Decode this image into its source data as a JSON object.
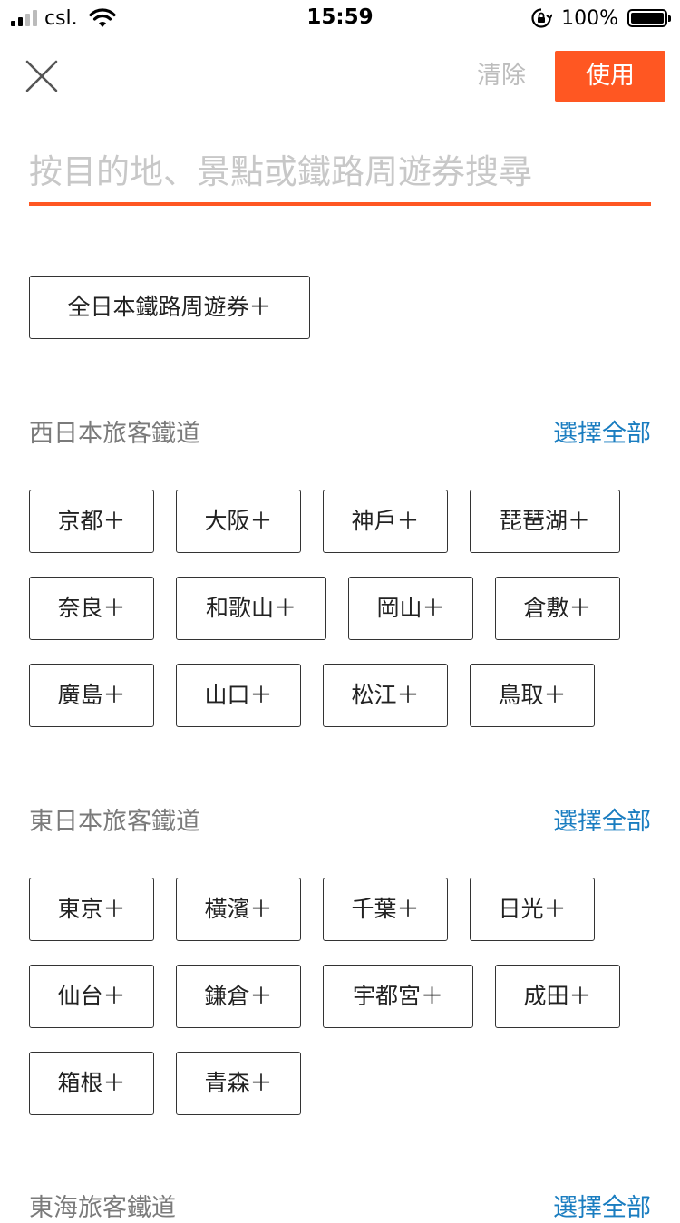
{
  "status_bar": {
    "carrier": "csl.",
    "time": "15:59",
    "battery_pct": "100%"
  },
  "top_bar": {
    "clear_label": "清除",
    "use_label": "使用"
  },
  "search": {
    "placeholder": "按目的地、景點或鐵路周遊券搜尋"
  },
  "all_japan_pass": "全日本鐵路周遊券＋",
  "sections": [
    {
      "title": "西日本旅客鐵道",
      "select_all": "選擇全部",
      "chips": [
        "京都＋",
        "大阪＋",
        "神戶＋",
        "琵琶湖＋",
        "奈良＋",
        "和歌山＋",
        "岡山＋",
        "倉敷＋",
        "廣島＋",
        "山口＋",
        "松江＋",
        "鳥取＋"
      ]
    },
    {
      "title": "東日本旅客鐵道",
      "select_all": "選擇全部",
      "chips": [
        "東京＋",
        "橫濱＋",
        "千葉＋",
        "日光＋",
        "仙台＋",
        "鎌倉＋",
        "宇都宮＋",
        "成田＋",
        "箱根＋",
        "青森＋"
      ]
    },
    {
      "title": "東海旅客鐵道",
      "select_all": "選擇全部",
      "chips": []
    }
  ],
  "colors": {
    "accent": "#ff5722",
    "link": "#1a7dc0"
  }
}
